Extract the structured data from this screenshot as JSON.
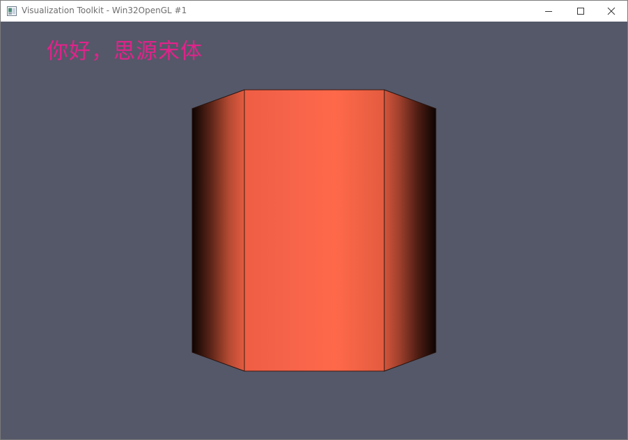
{
  "window": {
    "title": "Visualization Toolkit - Win32OpenGL #1",
    "icon": "vtk-window-icon",
    "controls": [
      "minimize-icon",
      "maximize-icon",
      "close-icon"
    ]
  },
  "scene": {
    "background_color": "#545869",
    "text_actor": {
      "text": "你好，思源宋体",
      "color": "#e0238a"
    },
    "actor": {
      "shape": "cylinder",
      "resolution": 8,
      "color": "#ff6347"
    }
  }
}
